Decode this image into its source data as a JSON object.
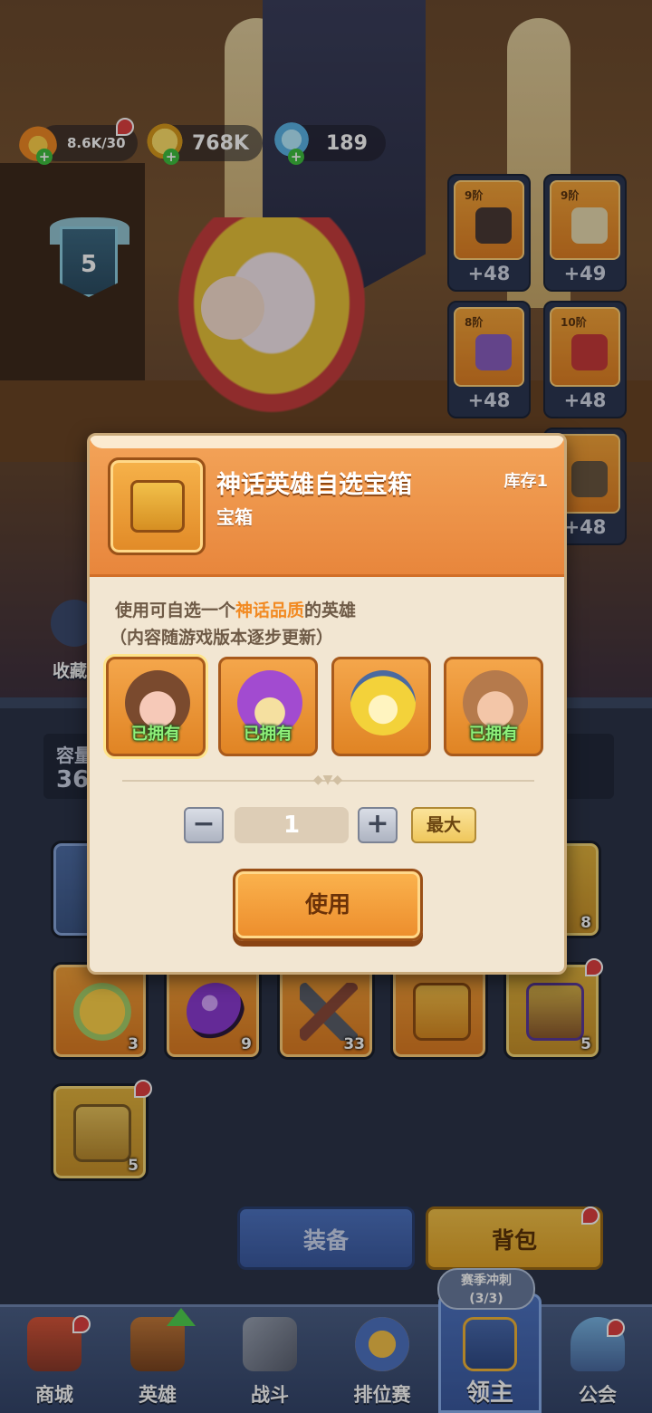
{
  "resources": {
    "energy": "8.6K/30",
    "gold": "768K",
    "gems": "189"
  },
  "level": "5",
  "equipment": [
    {
      "tier": "9阶",
      "bonus": "+48",
      "icon": "helmet-icon"
    },
    {
      "tier": "9阶",
      "bonus": "+49",
      "icon": "armor-icon"
    },
    {
      "tier": "8阶",
      "bonus": "+48",
      "icon": "boots-icon"
    },
    {
      "tier": "10阶",
      "bonus": "+48",
      "icon": "gloves-icon"
    },
    {
      "tier": "",
      "bonus": "+48",
      "icon": "belt-icon"
    }
  ],
  "side_labels": {
    "collection": "收藏"
  },
  "inventory": {
    "capacity_label": "容量",
    "capacity_value": "36",
    "items": [
      {
        "name": "honey-jar",
        "count": "3",
        "color": "#f4a23a"
      },
      {
        "name": "purple-orb",
        "count": "9",
        "color": "#f4a23a"
      },
      {
        "name": "pickaxe",
        "count": "33",
        "color": "#f4a23a"
      },
      {
        "name": "orange-chest",
        "count": "",
        "color": "#f4a23a"
      },
      {
        "name": "gold-chest",
        "count": "5",
        "color": "#e3b43e"
      },
      {
        "name": "wooden-chest",
        "count": "5",
        "color": "#e3b43e"
      }
    ],
    "side_count": "8"
  },
  "tabs": {
    "equipment": "装备",
    "backpack": "背包"
  },
  "season": {
    "line1": "赛季冲刺",
    "line2": "(3/3)"
  },
  "nav": [
    {
      "label": "商城",
      "icon": "shop-icon"
    },
    {
      "label": "英雄",
      "icon": "hero-card-icon"
    },
    {
      "label": "战斗",
      "icon": "battle-icon"
    },
    {
      "label": "排位赛",
      "icon": "ranked-icon"
    },
    {
      "label": "领主",
      "icon": "lord-icon"
    },
    {
      "label": "公会",
      "icon": "guild-icon"
    }
  ],
  "modal": {
    "title": "神话英雄自选宝箱",
    "subtitle": "宝箱",
    "stock": "库存1",
    "desc_prefix": "使用可自选一个",
    "desc_highlight": "神话品质",
    "desc_suffix": "的英雄",
    "desc_line2": "（内容随游戏版本逐步更新）",
    "heroes": [
      {
        "name": "brown-hair-hero",
        "owned": "已拥有",
        "color": "#7a4a2e"
      },
      {
        "name": "purple-flame-hero",
        "owned": "已拥有",
        "color": "#a24bd0"
      },
      {
        "name": "lightning-hero",
        "owned": "",
        "color": "#f3d23a"
      },
      {
        "name": "monkey-hero",
        "owned": "已拥有",
        "color": "#b57a4c"
      }
    ],
    "quantity": "1",
    "minus": "−",
    "plus": "+",
    "max": "最大",
    "use": "使用"
  },
  "colors": {
    "accent": "#f28a22",
    "owned": "#8ef07a",
    "nav_active": "#4e74c2"
  }
}
